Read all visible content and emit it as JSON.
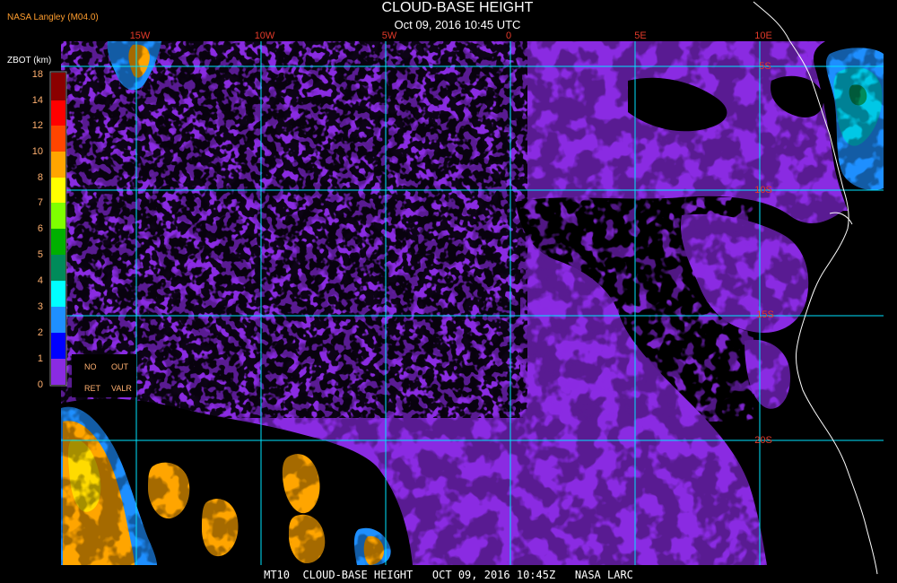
{
  "header": {
    "title": "CLOUD-BASE HEIGHT",
    "subtitle": "Oct 09, 2016 10:45 UTC",
    "producer": "NASA Langley (M04.0)"
  },
  "footer": "MT10  CLOUD-BASE HEIGHT   OCT 09, 2016 10:45Z   NASA LARC",
  "longitudes": [
    {
      "label": "15W",
      "value": -15
    },
    {
      "label": "10W",
      "value": -10
    },
    {
      "label": "5W",
      "value": -5
    },
    {
      "label": "0",
      "value": 0
    },
    {
      "label": "5E",
      "value": 5
    },
    {
      "label": "10E",
      "value": 10
    }
  ],
  "latitudes": [
    {
      "label": "5S",
      "value": -5
    },
    {
      "label": "10S",
      "value": -10
    },
    {
      "label": "15S",
      "value": -15
    },
    {
      "label": "20S",
      "value": -20
    }
  ],
  "legend": {
    "unit": "ZBOT (km)",
    "ticks": [
      "0",
      "1",
      "2",
      "3",
      "4",
      "5",
      "6",
      "7",
      "8",
      "10",
      "12",
      "14",
      "18"
    ],
    "no_label_1": "NO",
    "no_label_2": "RET",
    "out_label_1": "OUT",
    "out_label_2": "VALR",
    "colors": {
      "0_1": "#8a2be2",
      "1_2": "#0000ff",
      "2_3": "#1e8fff",
      "3_4": "#00ffff",
      "4_5": "#008b5a",
      "5_6": "#00b000",
      "6_7": "#7fff00",
      "7_8": "#ffff00",
      "8_10": "#ffa500",
      "10_12": "#ff4500",
      "12_14": "#ff0000",
      "14_18": "#8b0000"
    }
  },
  "colors": {
    "background": "#000000",
    "grid": "#00e5ff",
    "coastline": "#ffffff",
    "label_red": "#e33a2a",
    "tick_orange": "#ffb070"
  }
}
